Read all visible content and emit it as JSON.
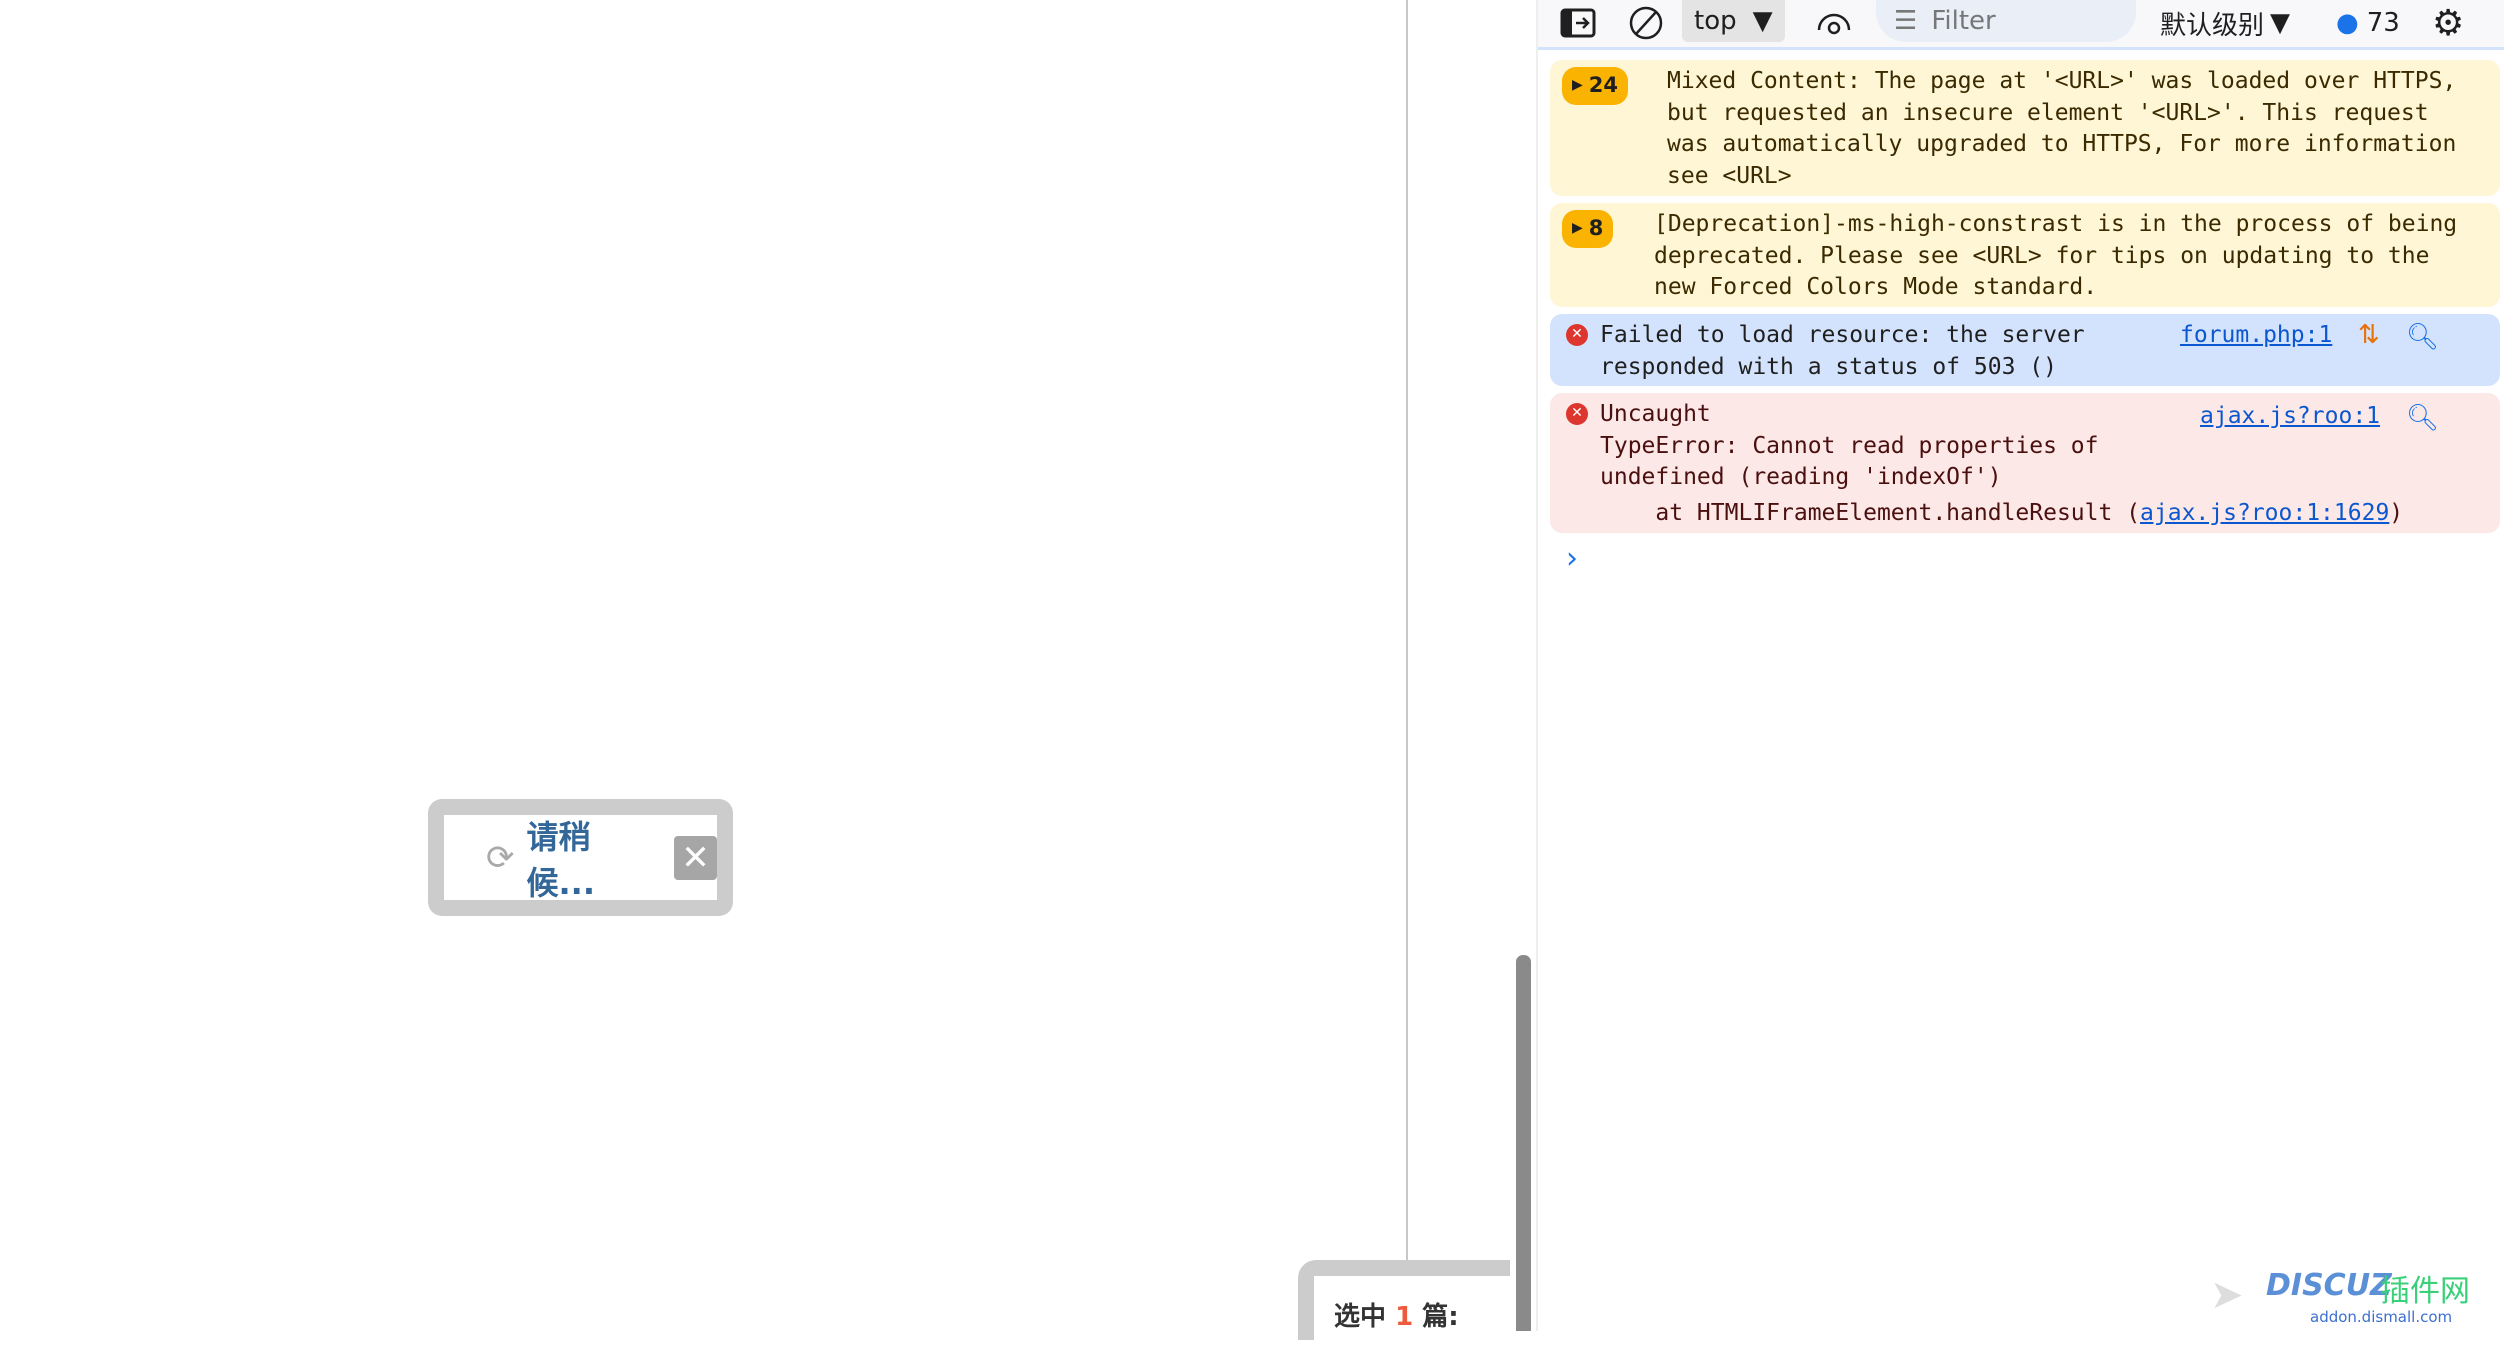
{
  "page": {
    "loading_text": "请稍候...",
    "close_symbol": "✕",
    "selected_prefix": "选中",
    "selected_count": "1",
    "selected_suffix": "篇:"
  },
  "devtools": {
    "toolbar": {
      "context": "top",
      "filter_placeholder": "Filter",
      "level": "默认级别",
      "message_count": "73"
    },
    "messages": [
      {
        "type": "warning",
        "count": "24",
        "text": "Mixed Content: The page at '<URL>' was loaded over HTTPS, but requested an insecure element '<URL>'. This request was automatically upgraded to HTTPS, For more information see <URL>"
      },
      {
        "type": "warning",
        "count": "8",
        "text": "[Deprecation]-ms-high-constrast is in the process of being deprecated. Please see <URL> for tips on updating to the new Forced Colors Mode standard."
      },
      {
        "type": "error",
        "text": "Failed to load resource: the server responded with a status of 503 ()",
        "source": "forum.php:1"
      },
      {
        "type": "error",
        "text_l1": "Uncaught",
        "text_l2": "TypeError: Cannot read properties of",
        "text_l3": "undefined (reading 'indexOf')",
        "stack_prefix": "    at HTMLIFrameElement.handleResult (",
        "stack_link": "ajax.js?roo:1:1629",
        "stack_suffix": ")",
        "source": "ajax.js?roo:1"
      }
    ]
  },
  "watermark": {
    "brand": "DISCUZ",
    "cn": "插件网",
    "url": "addon.dismall.com"
  },
  "colors": {
    "warning_bg": "#fef6d5",
    "info_bg": "#d3e3fd",
    "error_bg": "#fce8e6",
    "badge": "#f9b300",
    "link": "#0b57d0"
  }
}
